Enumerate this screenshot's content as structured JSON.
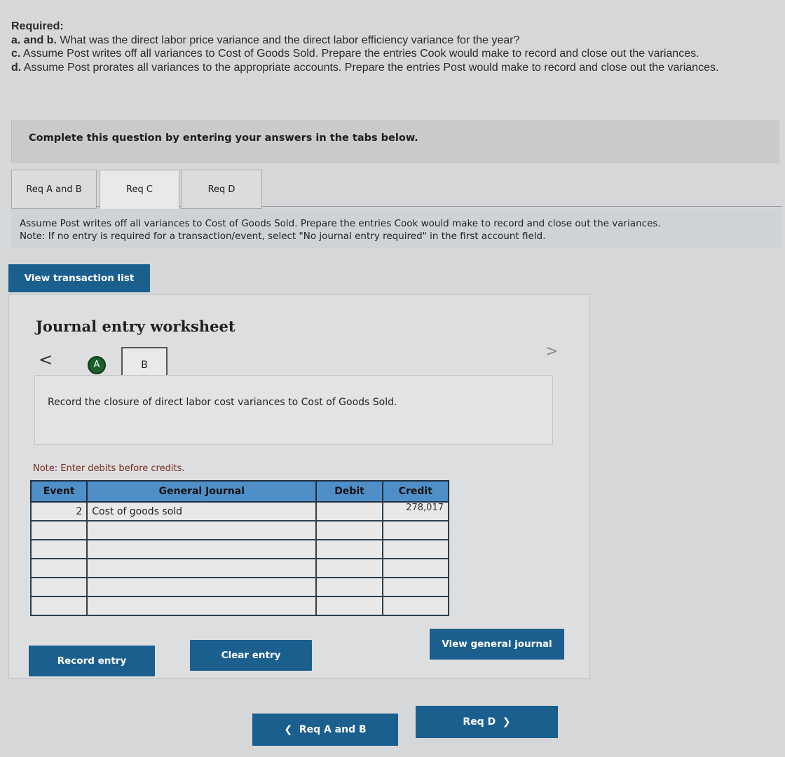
{
  "required": {
    "title": "Required:",
    "ab_prefix": "a. and b.",
    "ab_text": " What was the direct labor price variance and the direct labor efficiency variance for the year?",
    "c_prefix": "c.",
    "c_text": " Assume Post writes off all variances to Cost of Goods Sold. Prepare the entries Cook would make to record and close out the variances.",
    "d_prefix": "d.",
    "d_text": " Assume Post prorates all variances to the appropriate accounts. Prepare the entries Post would make to record and close out the variances."
  },
  "banner": "Complete this question by entering your answers in the tabs below.",
  "tabs": [
    {
      "label": "Req A and B",
      "active": false
    },
    {
      "label": "Req C",
      "active": true
    },
    {
      "label": "Req D",
      "active": false
    }
  ],
  "instructions": {
    "line1": "Assume Post writes off all variances to Cost of Goods Sold. Prepare the entries Cook would make to record and close out the variances.",
    "line2": "Note: If no entry is required for a transaction/event, select \"No journal entry required\" in the first account field."
  },
  "view_transaction_list": "View transaction list",
  "worksheet": {
    "title": "Journal entry worksheet",
    "nav_prev": "<",
    "nav_next": ">",
    "step_a": "A",
    "step_b": "B",
    "record_description": "Record the closure of direct labor cost variances to Cost of Goods Sold.",
    "note": "Note: Enter debits before credits.",
    "headers": {
      "event": "Event",
      "account": "General Journal",
      "debit": "Debit",
      "credit": "Credit"
    },
    "rows": [
      {
        "event": "2",
        "account": "Cost of goods sold",
        "debit": "",
        "credit": "278,017"
      },
      {
        "event": "",
        "account": "",
        "debit": "",
        "credit": ""
      },
      {
        "event": "",
        "account": "",
        "debit": "",
        "credit": ""
      },
      {
        "event": "",
        "account": "",
        "debit": "",
        "credit": ""
      },
      {
        "event": "",
        "account": "",
        "debit": "",
        "credit": ""
      },
      {
        "event": "",
        "account": "",
        "debit": "",
        "credit": ""
      }
    ],
    "record_entry": "Record entry",
    "clear_entry": "Clear entry",
    "view_general_journal": "View general journal"
  },
  "footer": {
    "prev_label": "Req A and B",
    "next_label": "Req D",
    "prev_glyph": "❮",
    "next_glyph": "❯"
  }
}
